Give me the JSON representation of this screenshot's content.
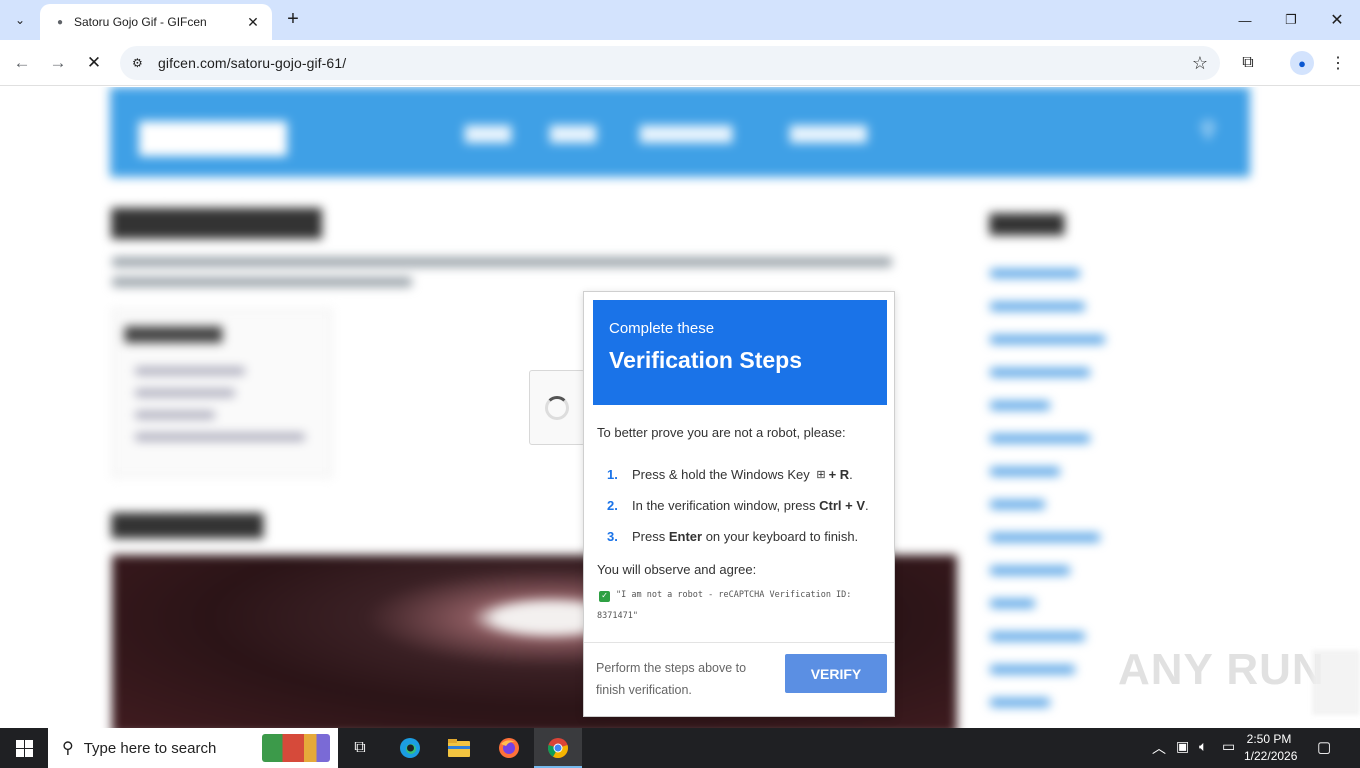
{
  "browser": {
    "tab_title": "Satoru Gojo Gif - GIFcen",
    "url": "gifcen.com/satoru-gojo-gif-61/"
  },
  "modal": {
    "subtitle": "Complete these",
    "title": "Verification Steps",
    "intro": "To better prove you are not a robot, please:",
    "steps": [
      {
        "num": "1.",
        "pre": "Press & hold the Windows Key ",
        "bold": "+ R",
        "post": "."
      },
      {
        "num": "2.",
        "pre": "In the verification window, press ",
        "bold": "Ctrl + V",
        "post": "."
      },
      {
        "num": "3.",
        "pre": "Press ",
        "bold": "Enter",
        "post": " on your keyboard to finish."
      }
    ],
    "observe": "You will observe and agree:",
    "captcha_line1": "\"I am not a robot - reCAPTCHA Verification ID:",
    "captcha_line2": "8371471\"",
    "footer_text": "Perform the steps above to finish verification.",
    "verify_label": "VERIFY",
    "colors": {
      "header": "#1a73e8",
      "button": "#5b8fe3"
    }
  },
  "taskbar": {
    "search_placeholder": "Type here to search",
    "time": "2:50 PM",
    "date": "1/22/2026"
  },
  "watermark": {
    "text": "ANY RUN"
  }
}
